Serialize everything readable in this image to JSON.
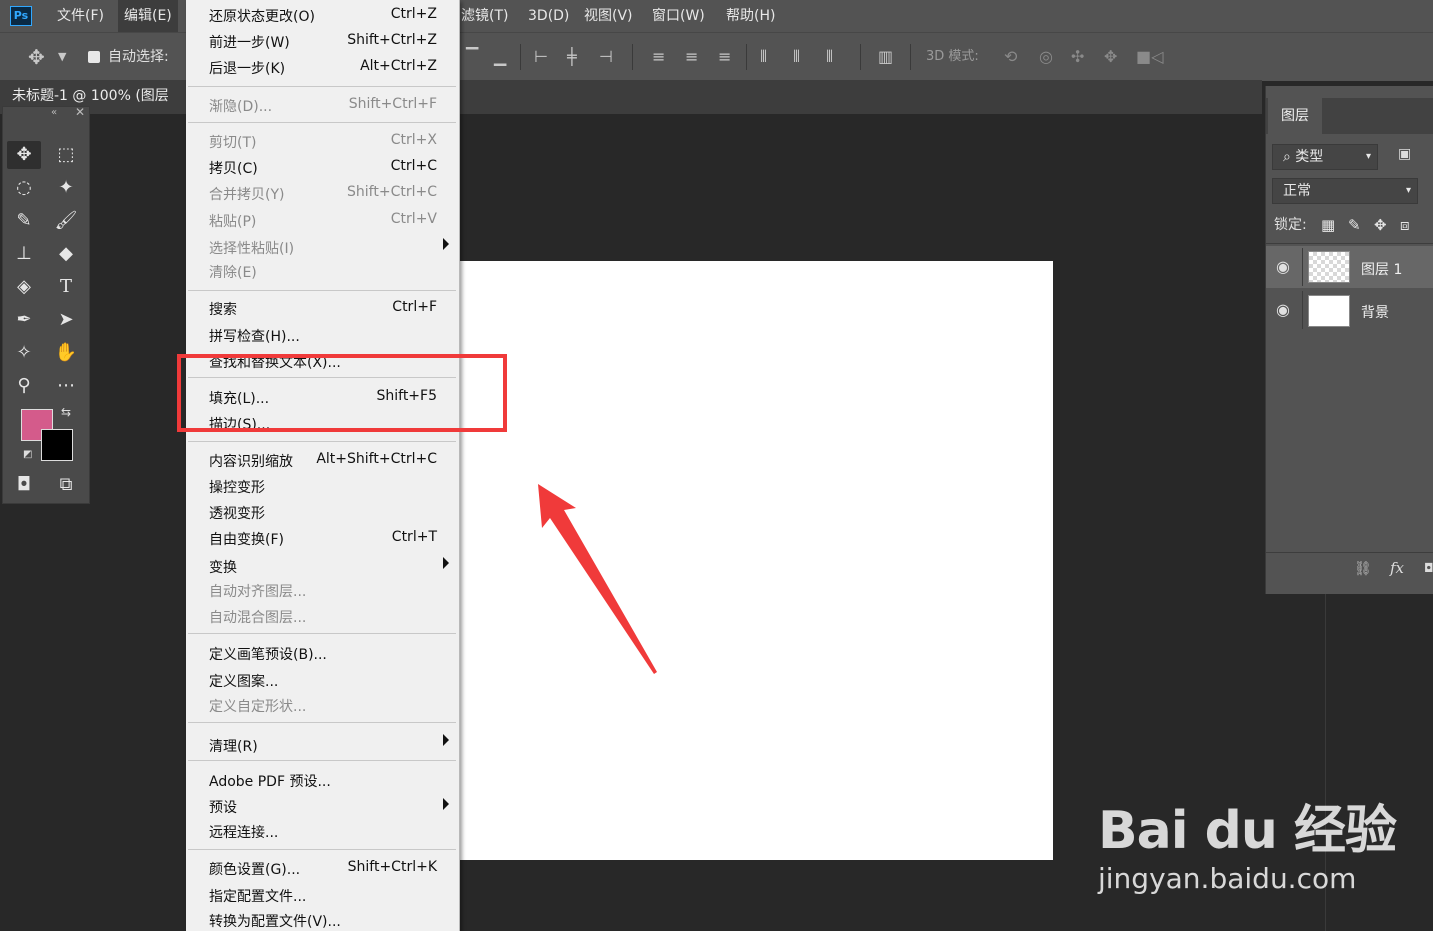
{
  "app": {
    "logo": "Ps"
  },
  "menubar": {
    "items": [
      "文件(F)",
      "编辑(E)",
      "滤镜(T)",
      "3D(D)",
      "视图(V)",
      "窗口(W)",
      "帮助(H)"
    ]
  },
  "options": {
    "auto_select_label": "自动选择:",
    "mode_3d_label": "3D 模式:"
  },
  "document": {
    "tab_title": "未标题-1 @ 100% (图层"
  },
  "edit_menu": {
    "items": [
      {
        "label": "还原状态更改(O)",
        "shortcut": "Ctrl+Z"
      },
      {
        "label": "前进一步(W)",
        "shortcut": "Shift+Ctrl+Z"
      },
      {
        "label": "后退一步(K)",
        "shortcut": "Alt+Ctrl+Z"
      },
      {
        "label": "渐隐(D)...",
        "shortcut": "Shift+Ctrl+F"
      },
      {
        "label": "剪切(T)",
        "shortcut": "Ctrl+X"
      },
      {
        "label": "拷贝(C)",
        "shortcut": "Ctrl+C"
      },
      {
        "label": "合并拷贝(Y)",
        "shortcut": "Shift+Ctrl+C"
      },
      {
        "label": "粘贴(P)",
        "shortcut": "Ctrl+V"
      },
      {
        "label": "选择性粘贴(I)",
        "shortcut": ""
      },
      {
        "label": "清除(E)",
        "shortcut": ""
      },
      {
        "label": "搜索",
        "shortcut": "Ctrl+F"
      },
      {
        "label": "拼写检查(H)...",
        "shortcut": ""
      },
      {
        "label": "查找和替换文本(X)...",
        "shortcut": ""
      },
      {
        "label": "填充(L)...",
        "shortcut": "Shift+F5"
      },
      {
        "label": "描边(S)...",
        "shortcut": ""
      },
      {
        "label": "内容识别缩放",
        "shortcut": "Alt+Shift+Ctrl+C"
      },
      {
        "label": "操控变形",
        "shortcut": ""
      },
      {
        "label": "透视变形",
        "shortcut": ""
      },
      {
        "label": "自由变换(F)",
        "shortcut": "Ctrl+T"
      },
      {
        "label": "变换",
        "shortcut": ""
      },
      {
        "label": "自动对齐图层...",
        "shortcut": ""
      },
      {
        "label": "自动混合图层...",
        "shortcut": ""
      },
      {
        "label": "定义画笔预设(B)...",
        "shortcut": ""
      },
      {
        "label": "定义图案...",
        "shortcut": ""
      },
      {
        "label": "定义自定形状...",
        "shortcut": ""
      },
      {
        "label": "清理(R)",
        "shortcut": ""
      },
      {
        "label": "Adobe PDF 预设...",
        "shortcut": ""
      },
      {
        "label": "预设",
        "shortcut": ""
      },
      {
        "label": "远程连接...",
        "shortcut": ""
      },
      {
        "label": "颜色设置(G)...",
        "shortcut": "Shift+Ctrl+K"
      },
      {
        "label": "指定配置文件...",
        "shortcut": ""
      },
      {
        "label": "转换为配置文件(V)...",
        "shortcut": ""
      }
    ]
  },
  "layers_panel": {
    "tab": "图层",
    "filter": "类型",
    "blend_mode": "正常",
    "lock_label": "锁定:",
    "layers": [
      {
        "name": "图层 1",
        "visible": true
      },
      {
        "name": "背景",
        "visible": true
      }
    ],
    "footer_fx": "fx"
  },
  "colors": {
    "foreground": "#d45b8b",
    "background": "#000000",
    "highlight_box": "#f03a3a",
    "arrow": "#f03a3a"
  },
  "watermark": {
    "logo": "Bai du 经验",
    "url": "jingyan.baidu.com"
  }
}
